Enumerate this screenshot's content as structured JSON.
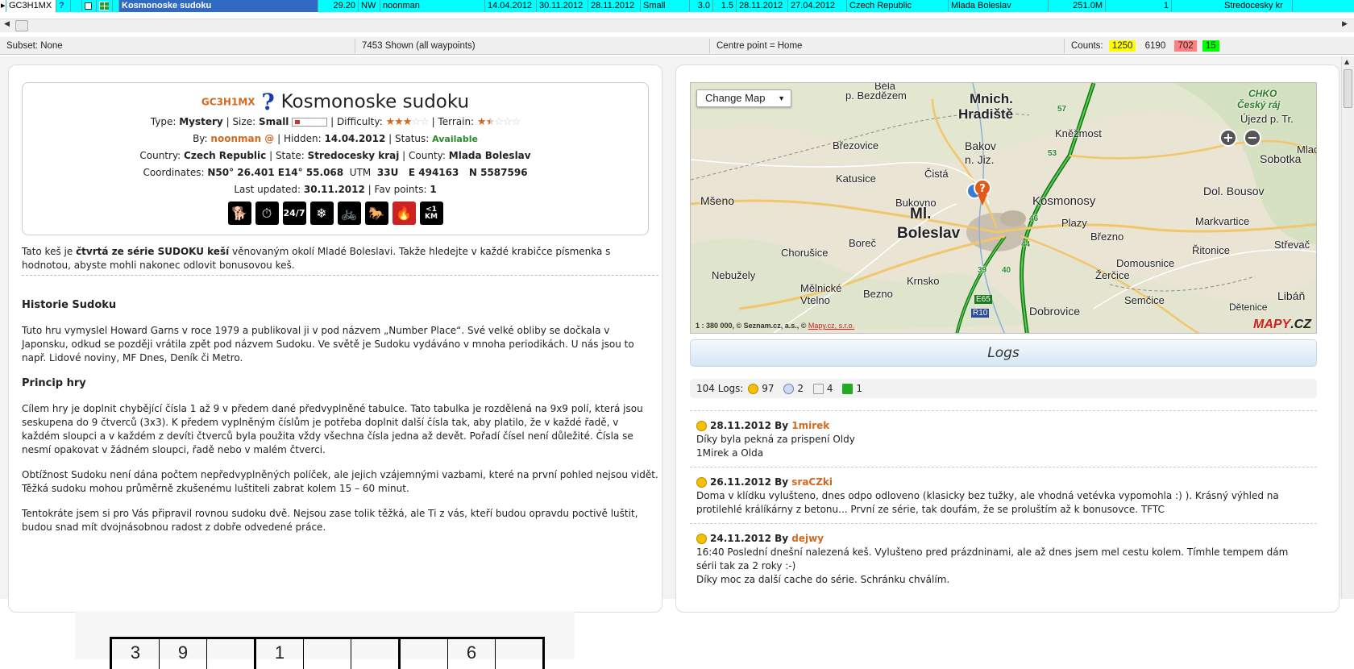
{
  "grid_row": {
    "code": "GC3H1MX",
    "name": "Kosmonoske sudoku",
    "distance": "29.20",
    "bearing": "NW",
    "placed_by": "noonman",
    "hidden": "14.04.2012",
    "last_updated": "30.11.2012",
    "last_found": "28.11.2012",
    "size": "Small",
    "difficulty": "3.0",
    "terrain": "1.5",
    "last_log": "28.11.2012",
    "last_gpx": "27.04.2012",
    "country": "Czech Republic",
    "county": "Mlada Boleslav",
    "elevation": "251.0M",
    "fav": "1",
    "state": "Stredocesky kr"
  },
  "statusbar": {
    "subset": "Subset: None",
    "shown": "7453 Shown (all waypoints)",
    "centre": "Centre point = Home",
    "counts_label": "Counts:",
    "counts": [
      {
        "value": "1250",
        "color": "#ffff00"
      },
      {
        "value": "6190",
        "color": "#f0f0f0"
      },
      {
        "value": "702",
        "color": "#ff8080"
      },
      {
        "value": "15",
        "color": "#00ff00"
      }
    ]
  },
  "cache": {
    "code": "GC3H1MX",
    "name": "Kosmonoske sudoku",
    "type_label": "Type:",
    "type": "Mystery",
    "size_label": "Size:",
    "size": "Small",
    "difficulty_label": "Difficulty:",
    "difficulty": 3.0,
    "terrain_label": "Terrain:",
    "terrain": 1.5,
    "by_label": "By:",
    "owner": "noonman @",
    "hidden_label": "Hidden:",
    "hidden": "14.04.2012",
    "status_label": "Status:",
    "status": "Available",
    "country_label": "Country:",
    "country": "Czech Republic",
    "state_label": "State:",
    "state": "Stredocesky kraj",
    "county_label": "County:",
    "county": "Mlada Boleslav",
    "coords_label": "Coordinates:",
    "coords": "N50° 26.401 E14° 55.068",
    "utm_label": "UTM",
    "utm": "33U   E 494163   N 5587596",
    "updated_label": "Last updated:",
    "updated": "30.11.2012",
    "fav_label": "Fav points:",
    "fav": "1",
    "attributes": [
      {
        "icon": "dog-icon",
        "glyph": "🐕"
      },
      {
        "icon": "stopwatch-icon",
        "glyph": "⏱"
      },
      {
        "icon": "24-7-icon",
        "glyph": "24/7"
      },
      {
        "icon": "snowflake-icon",
        "glyph": "❄"
      },
      {
        "icon": "bicycle-icon",
        "glyph": "🚲"
      },
      {
        "icon": "horse-icon",
        "glyph": "🐎"
      },
      {
        "icon": "no-campfire-icon",
        "glyph": "🔥"
      },
      {
        "icon": "under-1km-icon",
        "glyph": "<1 KM"
      }
    ]
  },
  "description": {
    "intro_1": "Tato keš je ",
    "intro_bold": "čtvrtá ze série SUDOKU keší",
    "intro_2": " věnovaným okolí Mladé Boleslavi. Takže hledejte v každé krabičce písmenka s hodnotou, abyste mohli nakonec odlovit bonusovou keš.",
    "h_history": "Historie Sudoku",
    "p_history": "Tuto hru vymyslel Howard Garns v roce 1979 a publikoval ji v pod názvem „Number Place“. Své velké obliby se dočkala v Japonsku, odkud se později vrátila zpět pod názvem Sudoku. Ve světě je Sudoku vydáváno v mnoha periodikách. U nás jsou to např. Lidové noviny, MF Dnes, Deník či Metro.",
    "h_principle": "Princip hry",
    "p_principle": "Cílem hry je doplnit chybějící čísla 1 až 9 v předem dané předvyplněné tabulce. Tato tabulka je rozdělená na 9x9 polí, která jsou seskupena do 9 čtverců (3x3). K předem vyplněným číslům je potřeba doplnit další čísla tak, aby platilo, že v každé řadě, v každém sloupci a v každém z devíti čtverců byla použita vždy všechna čísla jedna až devět. Pořadí čísel není důležité. Čísla se nesmí opakovat v žádném sloupci, řadě nebo v malém čtverci.",
    "p_difficulty": "Obtížnost Sudoku není dána počtem nepředvyplněných políček, ale jejich vzájemnými vazbami, které na první pohled nejsou vidět. Těžká sudoku mohou průměrně zkušenému luštiteli zabrat kolem 15 – 60 minut.",
    "p_this": "Tentokráte jsem si pro Vás připravil rovnou sudoku dvě. Nejsou zase tolik těžká, ale Ti z vás, kteří budou opravdu poctivě luštit, budou snad mít dvojnásobnou radost z dobře odvedené práce.",
    "sudoku_row": [
      "3",
      "9",
      "",
      "1",
      "",
      "",
      "",
      "6",
      ""
    ]
  },
  "map": {
    "change_map": "Change Map",
    "zoom_in": "+",
    "zoom_out": "−",
    "scale": "1 : 380 000, © Seznam.cz, a.s., © ",
    "scale_link": "Mapy.cz, s.r.o.",
    "logo_a": "MAPY",
    "logo_b": ".CZ",
    "labels": {
      "bela": "Bělá",
      "bezdezem": "p. Bezdězem",
      "mnich": "Mnich.",
      "hradiste": "Hradiště",
      "chko1": "CHKO",
      "chko2": "Český ráj",
      "ujezd": "Újezd p. Tr.",
      "knezmost": "Kněžmost",
      "brezovice": "Březovice",
      "bakov": "Bakov",
      "njiz": "n. Jiz.",
      "mlad": "Mlad",
      "sobotka": "Sobotka",
      "cista": "Čistá",
      "katusice": "Katusice",
      "dolbousov": "Dol. Bousov",
      "mseno": "Mšeno",
      "bukovno": "Bukovno",
      "kosmonosy": "Kosmonosy",
      "ml": "Ml.",
      "boleslav": "Boleslav",
      "plazy": "Plazy",
      "markvartice": "Markvartice",
      "brezno": "Březno",
      "borec": "Boreč",
      "strevac": "Střevač",
      "chorusice": "Chorušice",
      "ritonice": "Řitonice",
      "domousnice": "Domousnice",
      "nebuzely": "Nebužely",
      "zercice": "Žerčice",
      "krnsko": "Krnsko",
      "melnicke": "Mělnické",
      "vtelno": "Vtelno",
      "bezno": "Bezno",
      "semcice": "Semčice",
      "liban": "Libáň",
      "dobrovice": "Dobrovice",
      "detenice": "Dětenice",
      "r57": "57",
      "r53": "53",
      "r46": "46",
      "r44": "44",
      "r40": "40",
      "r39": "39",
      "e65": "E65",
      "r10": "R10"
    }
  },
  "logs": {
    "title": "Logs",
    "summary_count": "104 Logs:",
    "counts": [
      {
        "icon": "smiley-found-icon",
        "value": "97",
        "color": "#f5c000"
      },
      {
        "icon": "frown-dnf-icon",
        "value": "2",
        "color": "#9fb4e0"
      },
      {
        "icon": "note-icon",
        "value": "4",
        "color": "#e8e8e8"
      },
      {
        "icon": "maintenance-icon",
        "value": "1",
        "color": "#22aa22"
      }
    ],
    "entries": [
      {
        "date": "28.11.2012",
        "by": "By",
        "author": "1mirek",
        "text": "Díky byla pekná za prispení Oldy\n1Mirek a Olda"
      },
      {
        "date": "26.11.2012",
        "by": "By",
        "author": "sraCZki",
        "text": "Doma v klídku vylušteno, dnes odpo odloveno (klasicky bez tužky, ale vhodná vetévka vypomohla :) ). Krásný výhled na protilehlé králíkárny z betonu... První ze série, tak doufám, že se proluštím až k bonusovce. TFTC"
      },
      {
        "date": "24.11.2012",
        "by": "By",
        "author": "dejwy",
        "text": "16:40 Poslední dnešní nalezená keš. Vylušteno pred prázdninami, ale až dnes jsem mel cestu kolem. Tímhle tempem dám sérii tak za 2 roky :-)\nDíky moc za další cache do série. Schránku chválím."
      }
    ]
  }
}
